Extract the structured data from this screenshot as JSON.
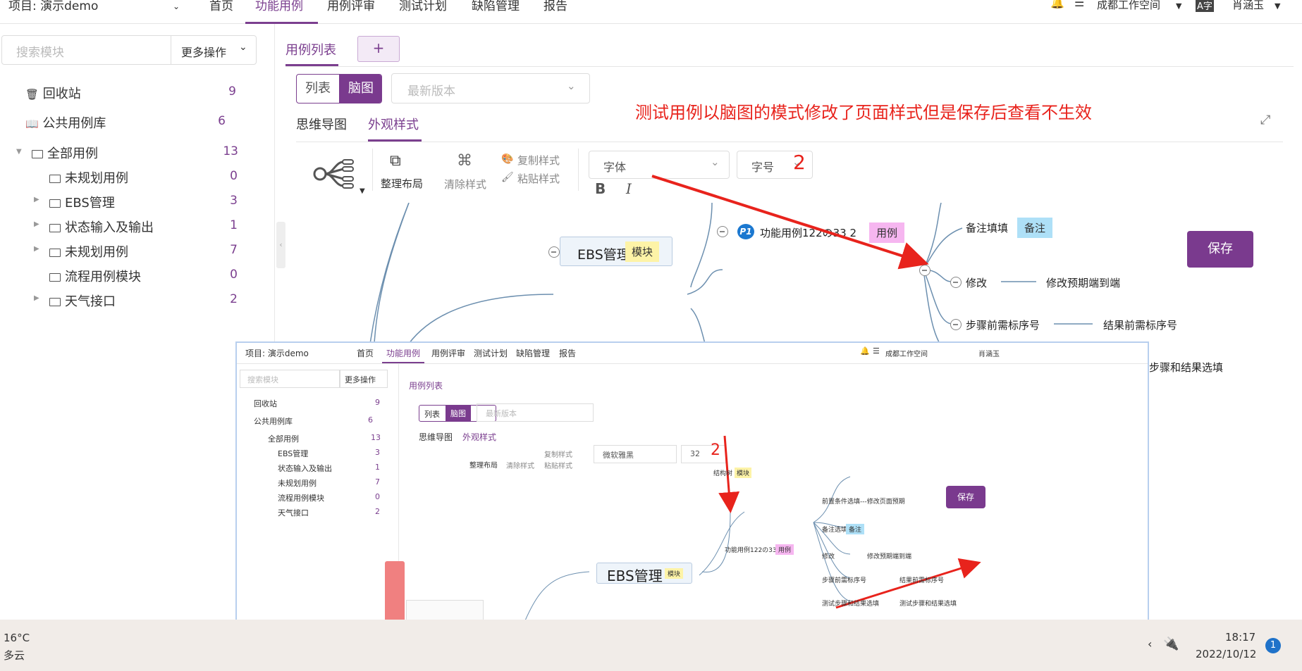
{
  "topnav": {
    "project": "项目: 演示demo",
    "tabs": [
      "首页",
      "功能用例",
      "用例评审",
      "测试计划",
      "缺陷管理",
      "报告"
    ],
    "active_tab": "功能用例",
    "workspace": "成都工作空间",
    "user": "肖涵玉"
  },
  "sidebar": {
    "search_placeholder": "搜索模块",
    "more_ops": "更多操作",
    "items": [
      {
        "label": "回收站",
        "count": "9"
      },
      {
        "label": "公共用例库",
        "count": "6"
      },
      {
        "label": "全部用例",
        "count": "13"
      },
      {
        "label": "未规划用例",
        "count": "0"
      },
      {
        "label": "EBS管理",
        "count": "3"
      },
      {
        "label": "状态输入及输出",
        "count": "1"
      },
      {
        "label": "未规划用例",
        "count": "7"
      },
      {
        "label": "流程用例模块",
        "count": "0"
      },
      {
        "label": "天气接口",
        "count": "2"
      }
    ]
  },
  "main": {
    "tab_case_list": "用例列表",
    "tab_add": "+",
    "view_list": "列表",
    "view_mind": "脑图",
    "version_placeholder": "最新版本",
    "subtab_mindmap": "思维导图",
    "subtab_style": "外观样式",
    "annotation": "测试用例以脑图的模式修改了页面样式但是保存后查看不生效",
    "toolbar": {
      "tidy": "整理布局",
      "clear": "清除样式",
      "copy": "复制样式",
      "paste": "粘贴样式",
      "font": "字体",
      "size": "字号",
      "bold": "B",
      "italic": "I"
    },
    "marker_2": "2",
    "save": "保存",
    "mind": {
      "root": "EBS管理",
      "root_tag": "模块",
      "case": "功能用例122の33 2",
      "case_prio": "P1",
      "case_tag": "用例",
      "n_note": "备注填填",
      "n_note_tag": "备注",
      "n_modify": "修改",
      "n_modify_val": "修改预期端到端",
      "n_step": "步骤前需标序号",
      "n_step_val": "结果前需标序号",
      "n_test": "步骤和结果选填"
    }
  },
  "inner": {
    "project": "项目: 演示demo",
    "tabs": [
      "首页",
      "功能用例",
      "用例评审",
      "测试计划",
      "缺陷管理",
      "报告"
    ],
    "workspace": "成都工作空间",
    "user": "肖涵玉",
    "search_placeholder": "搜索模块",
    "more_ops": "更多操作",
    "items": [
      {
        "label": "回收站",
        "count": "9"
      },
      {
        "label": "公共用例库",
        "count": "6"
      },
      {
        "label": "全部用例",
        "count": "13"
      },
      {
        "label": "EBS管理",
        "count": "3"
      },
      {
        "label": "状态输入及输出",
        "count": "1"
      },
      {
        "label": "未规划用例",
        "count": "7"
      },
      {
        "label": "流程用例模块",
        "count": "0"
      },
      {
        "label": "天气接口",
        "count": "2"
      }
    ],
    "tab_case_list": "用例列表",
    "view_list": "列表",
    "view_mind": "脑图",
    "version_placeholder": "最新版本",
    "subtab_mindmap": "思维导图",
    "subtab_style": "外观样式",
    "tidy": "整理布局",
    "clear": "清除样式",
    "copy": "复制样式",
    "paste": "粘贴样式",
    "font": "微软雅黑",
    "size": "32",
    "marker_2": "2",
    "save": "保存",
    "root": "EBS管理",
    "root_tag": "模块",
    "n_struct": "结构树",
    "n_struct_tag": "模块",
    "case": "功能用例122の33 2",
    "case_tag": "用例",
    "n_pre": "前置条件选填---修改页面预期",
    "n_pre_tag": "前置",
    "n_note": "备注选填",
    "n_note_tag": "备注",
    "n_modify": "修改",
    "n_modify_val": "修改预期端到端",
    "n_step": "步骤前需标序号",
    "n_step_val": "结果前需标序号",
    "n_test": "测试步骤和结果选填",
    "n_test_val": "测试步骤和结果选填"
  },
  "taskbar": {
    "temp": "16°C",
    "weather": "多云",
    "time": "18:17",
    "date": "2022/10/12",
    "badge": "1"
  }
}
